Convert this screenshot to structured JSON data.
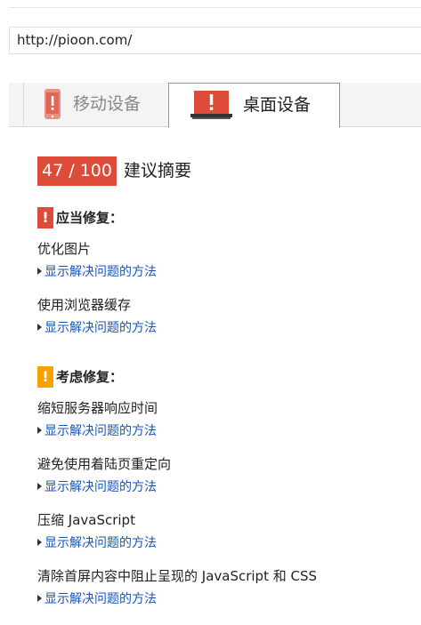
{
  "url_bar": {
    "value": "http://pioon.com/"
  },
  "tabs": [
    {
      "label": "移动设备",
      "icon": "mobile-phone-icon"
    },
    {
      "label": "桌面设备",
      "icon": "laptop-icon",
      "active": true
    }
  ],
  "summary": {
    "score": "47 / 100",
    "title": "建议摘要"
  },
  "should_fix": {
    "title": "应当修复：",
    "icon": "exclamation-icon",
    "color": "#dd4b39",
    "rules": [
      {
        "title": "优化图片",
        "link": "显示解决问题的方法"
      },
      {
        "title": "使用浏览器缓存",
        "link": "显示解决问题的方法"
      }
    ]
  },
  "consider_fixing": {
    "title": "考虑修复：",
    "icon": "exclamation-icon",
    "color": "#f6a200",
    "rules": [
      {
        "title": "缩短服务器响应时间",
        "link": "显示解决问题的方法"
      },
      {
        "title": "避免使用着陆页重定向",
        "link": "显示解决问题的方法"
      },
      {
        "title": "压缩 JavaScript",
        "link": "显示解决问题的方法"
      },
      {
        "title": "清除首屏内容中阻止呈现的 JavaScript 和 CSS",
        "link": "显示解决问题的方法"
      }
    ]
  }
}
